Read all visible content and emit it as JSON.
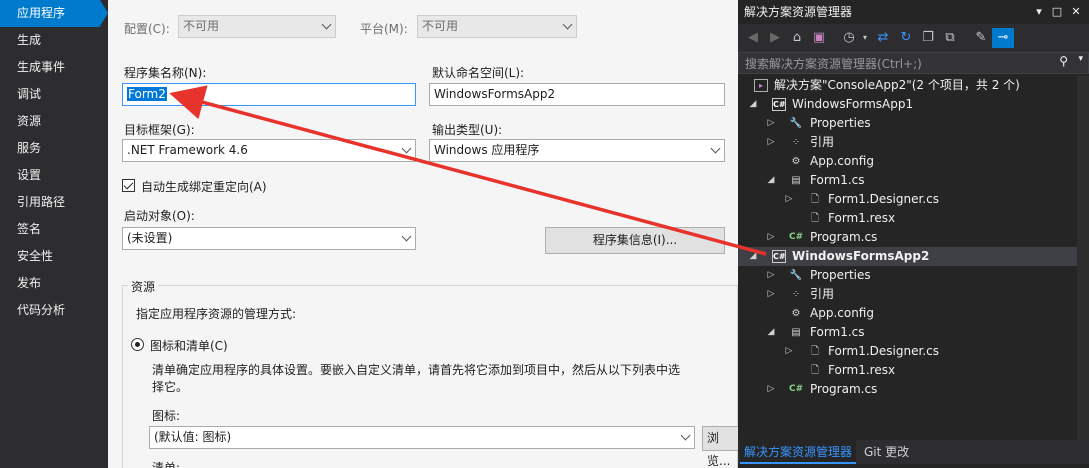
{
  "nav": {
    "items": [
      "应用程序",
      "生成",
      "生成事件",
      "调试",
      "资源",
      "服务",
      "设置",
      "引用路径",
      "签名",
      "安全性",
      "发布",
      "代码分析"
    ]
  },
  "main": {
    "config_label": "配置(C):",
    "config_value": "不可用",
    "platform_label": "平台(M):",
    "platform_value": "不可用",
    "assembly_name_label": "程序集名称(N):",
    "assembly_name_value": "Form2",
    "default_ns_label": "默认命名空间(L):",
    "default_ns_value": "WindowsFormsApp2",
    "target_fw_label": "目标框架(G):",
    "target_fw_value": ".NET Framework 4.6",
    "output_type_label": "输出类型(U):",
    "output_type_value": "Windows 应用程序",
    "auto_binding_label": "自动生成绑定重定向(A)",
    "startup_label": "启动对象(O):",
    "startup_value": "(未设置)",
    "assembly_info_button": "程序集信息(I)...",
    "resources_group": "资源",
    "resources_desc": "指定应用程序资源的管理方式:",
    "icon_manifest_label": "图标和清单(C)",
    "icon_manifest_desc_1": "清单确定应用程序的具体设置。要嵌入自定义清单，请首先将它添加到项目中，然后从以下列表中选",
    "icon_manifest_desc_2": "择它。",
    "icon_label": "图标:",
    "icon_value": "(默认值: 图标)",
    "browse_button": "浏览...",
    "manifest_label": "清单:"
  },
  "solution_explorer": {
    "title": "解决方案资源管理器",
    "title_controls": [
      "▾",
      "□",
      "✕"
    ],
    "search_placeholder": "搜索解决方案资源管理器(Ctrl+;)",
    "solution": "解决方案\"ConsoleApp2\"(2 个项目，共 2 个)",
    "project1": "WindowsFormsApp1",
    "project2": "WindowsFormsApp2",
    "properties": "Properties",
    "references": "引用",
    "app_config": "App.config",
    "form1_cs": "Form1.cs",
    "form1_designer": "Form1.Designer.cs",
    "form1_resx": "Form1.resx",
    "program_cs": "Program.cs",
    "tab_active": "解决方案资源管理器",
    "tab_git": "Git 更改"
  },
  "colors": {
    "accent": "#007acc",
    "arrow": "#e8322c",
    "dark_bg": "#252526"
  }
}
